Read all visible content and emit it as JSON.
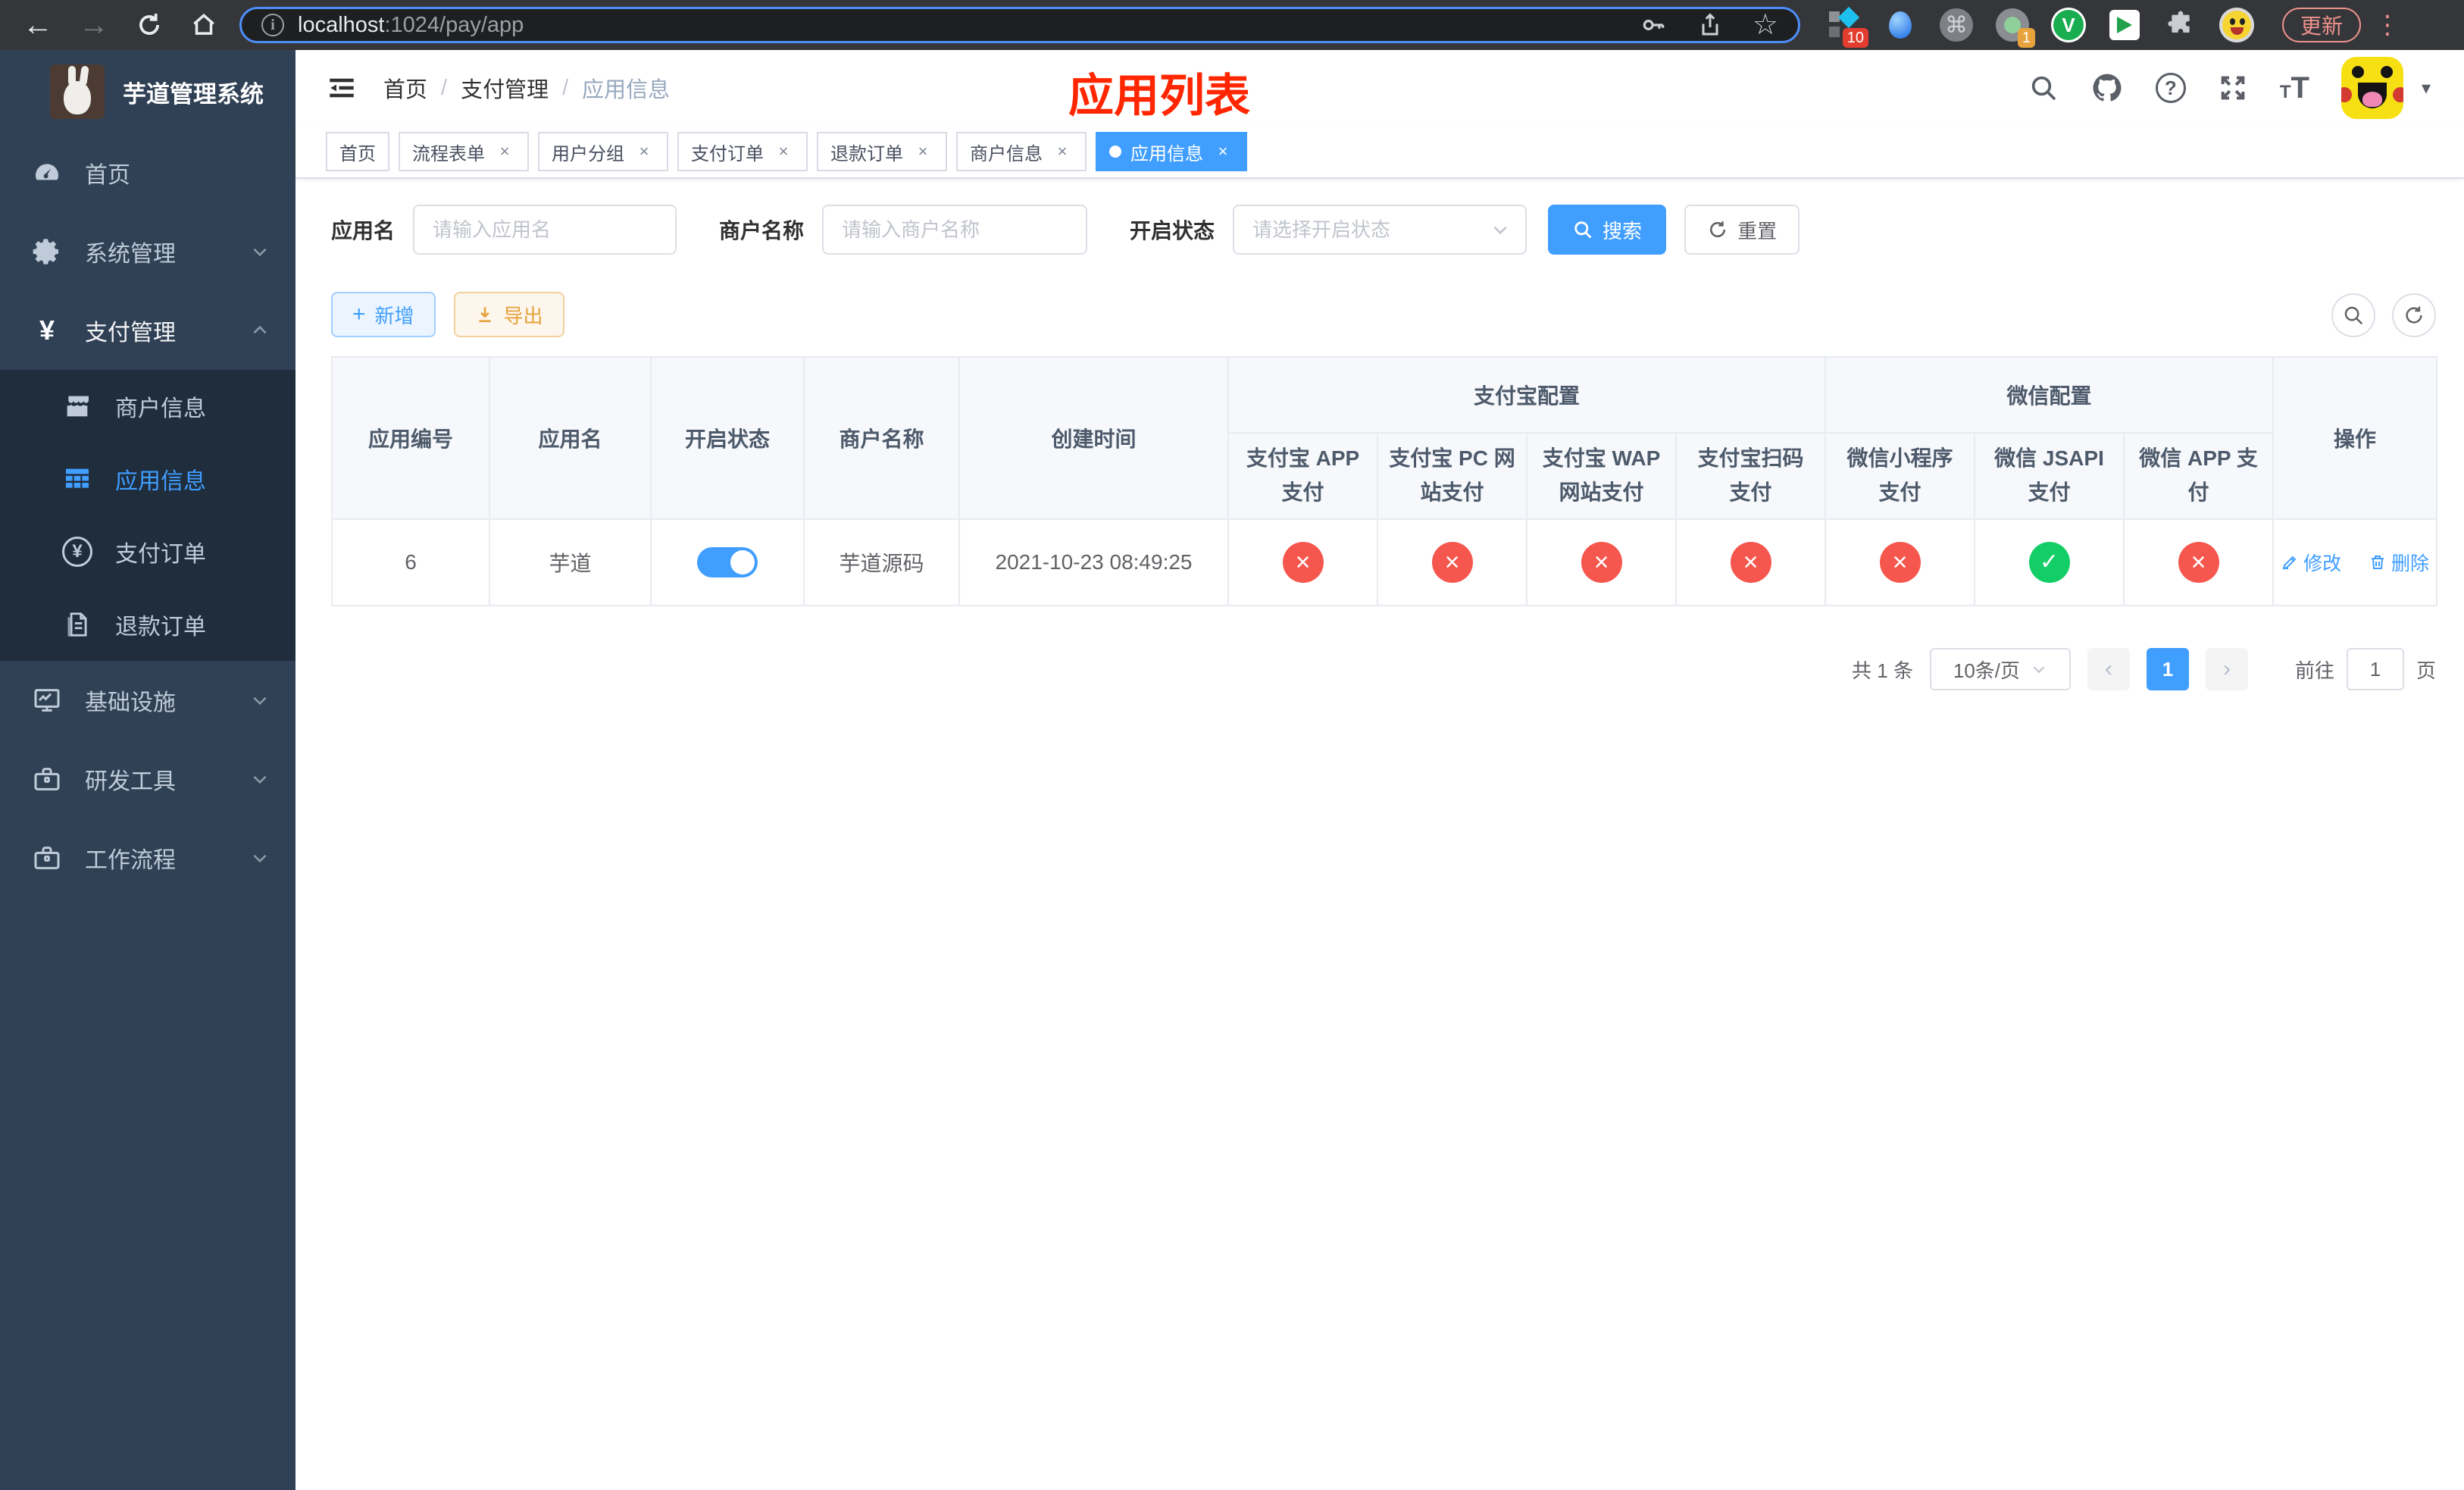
{
  "browser": {
    "url": {
      "host": "localhost",
      "path": ":1024/pay/app"
    },
    "update_label": "更新",
    "ext_badge_diamond": "10",
    "ext_badge_session": "1",
    "ext_v_letter": "V",
    "cmd_glyph": "⌘"
  },
  "sidebar": {
    "title": "芋道管理系统",
    "menu": [
      {
        "label": "首页"
      },
      {
        "label": "系统管理"
      },
      {
        "label": "支付管理"
      },
      {
        "label": "商户信息"
      },
      {
        "label": "应用信息"
      },
      {
        "label": "支付订单"
      },
      {
        "label": "退款订单"
      },
      {
        "label": "基础设施"
      },
      {
        "label": "研发工具"
      },
      {
        "label": "工作流程"
      }
    ]
  },
  "navbar": {
    "breadcrumb": [
      "首页",
      "支付管理",
      "应用信息"
    ]
  },
  "annotation": "应用列表",
  "tabs": [
    {
      "label": "首页"
    },
    {
      "label": "流程表单"
    },
    {
      "label": "用户分组"
    },
    {
      "label": "支付订单"
    },
    {
      "label": "退款订单"
    },
    {
      "label": "商户信息"
    },
    {
      "label": "应用信息"
    }
  ],
  "filters": {
    "app_name_label": "应用名",
    "app_name_placeholder": "请输入应用名",
    "merchant_label": "商户名称",
    "merchant_placeholder": "请输入商户名称",
    "status_label": "开启状态",
    "status_placeholder": "请选择开启状态",
    "search_label": "搜索",
    "reset_label": "重置"
  },
  "toolbar": {
    "add_label": "新增",
    "export_label": "导出"
  },
  "table": {
    "headers_main": [
      "应用编号",
      "应用名",
      "开启状态",
      "商户名称",
      "创建时间"
    ],
    "group_alipay": "支付宝配置",
    "group_wechat": "微信配置",
    "col_action": "操作",
    "headers_pay": [
      "支付宝 APP 支付",
      "支付宝 PC 网站支付",
      "支付宝 WAP 网站支付",
      "支付宝扫码支付",
      "微信小程序支付",
      "微信 JSAPI 支付",
      "微信 APP 支付"
    ],
    "row": {
      "id": "6",
      "name": "芋道",
      "enabled": true,
      "merchant": "芋道源码",
      "created_at": "2021-10-23 08:49:25",
      "pay_status": [
        "fail",
        "fail",
        "fail",
        "fail",
        "fail",
        "success",
        "fail"
      ],
      "edit_label": "修改",
      "delete_label": "删除"
    }
  },
  "pagination": {
    "total_label": "共 1 条",
    "page_size": "10条/页",
    "current_page": "1",
    "goto_label": "前往",
    "goto_value": "1",
    "page_suffix": "页"
  },
  "colors": {
    "primary": "#409eff",
    "danger": "#f5574e",
    "success": "#13ce66",
    "warning": "#e6a23c",
    "annotation": "#ff2600",
    "sidebar": "#304156"
  }
}
